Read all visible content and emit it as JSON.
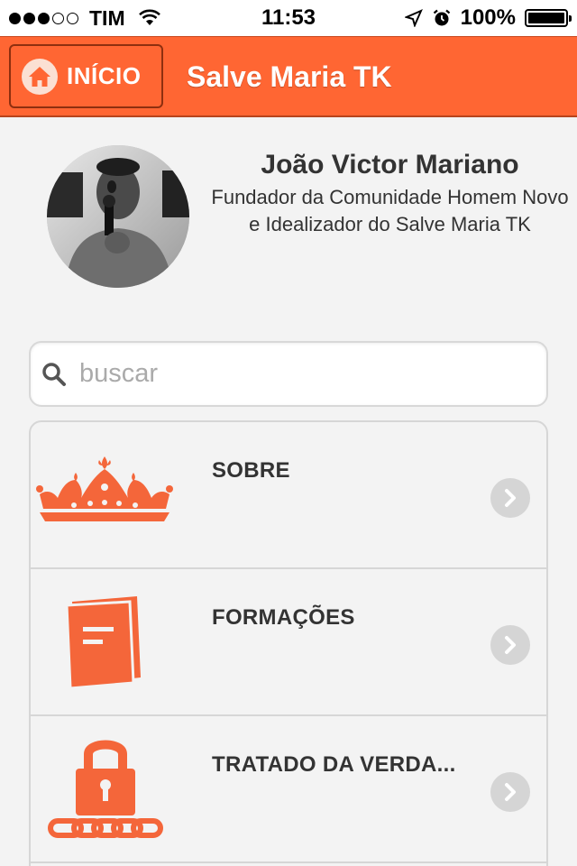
{
  "status_bar": {
    "carrier": "TIM",
    "time": "11:53",
    "battery": "100%",
    "signal_bars_filled": 3,
    "signal_bars_total": 5,
    "battery_level": 1.0
  },
  "header": {
    "home_label": "INÍCIO",
    "title": "Salve Maria TK",
    "accent": "#ff6633"
  },
  "profile": {
    "name": "João Victor Mariano",
    "description": "Fundador da Comunidade Homem Novo e Idealizador do Salve Maria TK"
  },
  "search": {
    "placeholder": "buscar",
    "value": ""
  },
  "menu": {
    "items": [
      {
        "label": "SOBRE",
        "icon": "crown-icon"
      },
      {
        "label": "FORMAÇÕES",
        "icon": "book-icon"
      },
      {
        "label": "TRATADO DA VERDA...",
        "icon": "padlock-chain-icon"
      }
    ]
  },
  "colors": {
    "icon_orange": "#f4663a",
    "chevron_bg": "#d5d5d5"
  }
}
